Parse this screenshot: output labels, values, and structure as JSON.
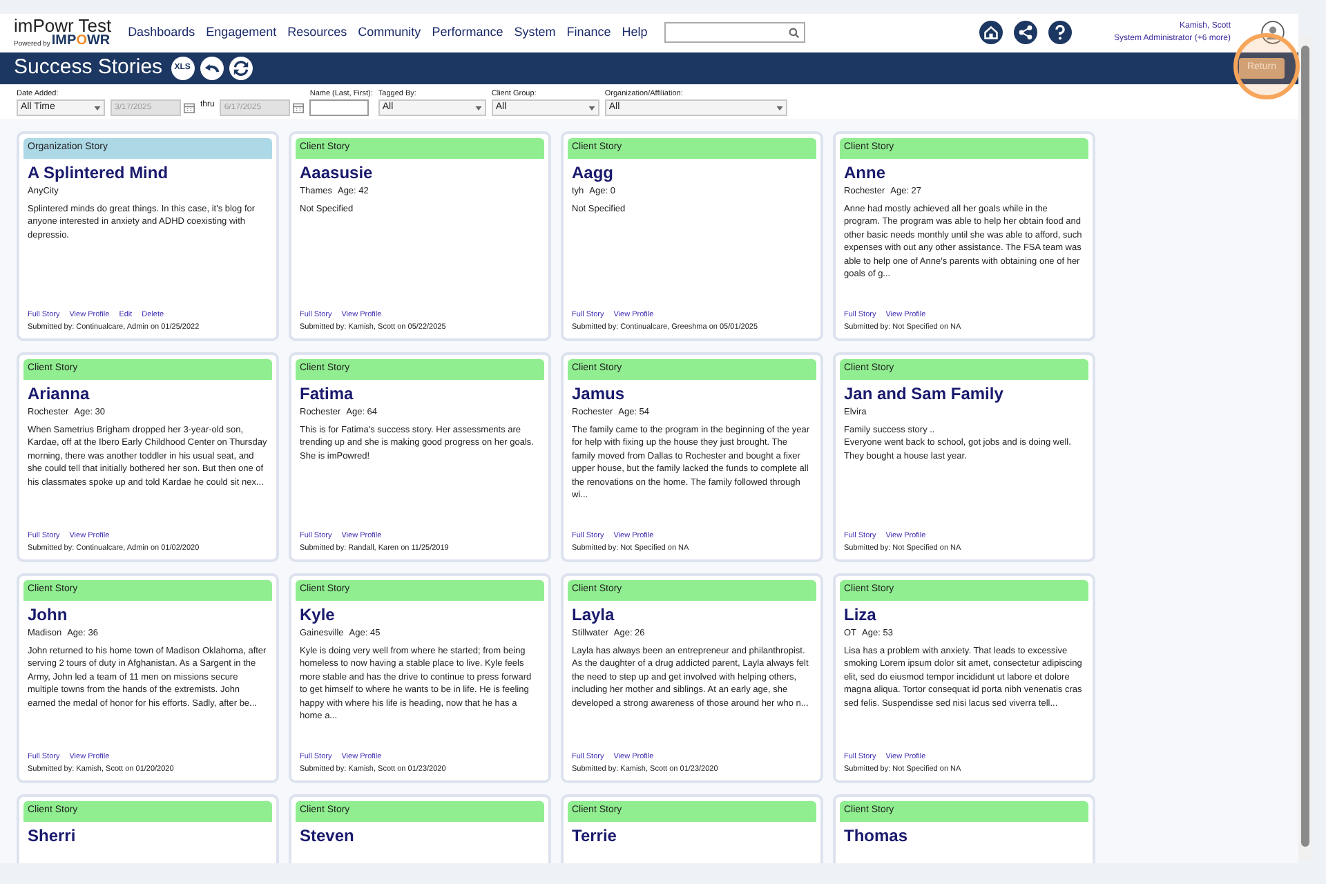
{
  "logo": {
    "title": "imPowr Test",
    "powered_by": "Powered by",
    "brand_parts": [
      {
        "text": "IMP",
        "accent": false
      },
      {
        "text": "O",
        "accent": true
      },
      {
        "text": "WR",
        "accent": false
      }
    ]
  },
  "nav": [
    "Dashboards",
    "Engagement",
    "Resources",
    "Community",
    "Performance",
    "System",
    "Finance",
    "Help"
  ],
  "user": {
    "name": "Kamish, Scott",
    "role": "System Administrator (+6 more)"
  },
  "toolbar": {
    "title": "Success Stories",
    "export_label": "XLS",
    "return_button": "Return",
    "return_highlighted": true
  },
  "filters": [
    {
      "kind": "select",
      "label": "Date Added:",
      "value": "All Time"
    },
    {
      "kind": "date",
      "value": "3/17/2025",
      "disabled": true
    },
    {
      "kind": "text",
      "label": "thru"
    },
    {
      "kind": "date",
      "value": "6/17/2025",
      "disabled": true
    },
    {
      "kind": "input",
      "label": "Name (Last, First):"
    },
    {
      "kind": "select",
      "label": "Tagged By:",
      "value": "All"
    },
    {
      "kind": "select",
      "label": "Client Group:",
      "value": "All"
    },
    {
      "kind": "select",
      "label": "Organization/Affiliation:",
      "value": "All"
    }
  ],
  "stories": [
    {
      "tag": "Organization Story",
      "color": "#add8e6",
      "name": "A Splintered Mind",
      "location": "AnyCity",
      "excerpt": "Splintered minds do great things. In this case, it's blog for anyone interested in anxiety and ADHD coexisting with depressio.",
      "links": [
        "Full Story",
        "View Profile",
        "Edit",
        "Delete"
      ],
      "submitted": "Submitted by: Continualcare, Admin on 01/25/2022"
    },
    {
      "tag": "Client Story",
      "color": "#90ee90",
      "name": "Aaasusie",
      "location": "Thames",
      "age": "Age: 42",
      "excerpt": "Not Specified",
      "links": [
        "Full Story",
        "View Profile"
      ],
      "submitted": "Submitted by: Kamish, Scott on 05/22/2025"
    },
    {
      "tag": "Client Story",
      "color": "#90ee90",
      "name": "Aagg",
      "location": "tyh",
      "age": "Age: 0",
      "excerpt": "Not Specified",
      "links": [
        "Full Story",
        "View Profile"
      ],
      "submitted": "Submitted by: Continualcare, Greeshma on 05/01/2025"
    },
    {
      "tag": "Client Story",
      "color": "#90ee90",
      "name": "Anne",
      "location": "Rochester",
      "age": "Age: 27",
      "excerpt": "Anne had mostly achieved all her goals while in the program. The program was able to help her obtain food and other basic needs monthly until she was able to afford, such expenses with out any other assistance. The FSA team was able to help one of Anne's parents with obtaining one of her goals of g...",
      "links": [
        "Full Story",
        "View Profile"
      ],
      "submitted": "Submitted by: Not Specified on NA"
    },
    {
      "tag": "Client Story",
      "color": "#90ee90",
      "name": "Arianna",
      "location": "Rochester",
      "age": "Age: 30",
      "excerpt": "When Sametrius Brigham dropped her 3-year-old son, Kardae, off at the Ibero Early Childhood Center on Thursday morning, there was another toddler in his usual seat, and she could tell that initially bothered her son. But then one of his classmates spoke up and told Kardae he could sit nex...",
      "links": [
        "Full Story",
        "View Profile"
      ],
      "submitted": "Submitted by: Continualcare, Admin on 01/02/2020"
    },
    {
      "tag": "Client Story",
      "color": "#90ee90",
      "name": "Fatima",
      "location": "Rochester",
      "age": "Age: 64",
      "excerpt": "This is for Fatima's success story.  Her assessments are trending up and she is making good progress on her goals.  She is imPowred!",
      "links": [
        "Full Story",
        "View Profile"
      ],
      "submitted": "Submitted by: Randall, Karen on 11/25/2019"
    },
    {
      "tag": "Client Story",
      "color": "#90ee90",
      "name": "Jamus",
      "location": "Rochester",
      "age": "Age: 54",
      "excerpt": "The family came to the program in the beginning of the year for help with fixing up the house they just brought. The family moved from Dallas to Rochester and bought a fixer upper house, but the family lacked the funds to complete all the renovations on the home. The family followed through wi...",
      "links": [
        "Full Story",
        "View Profile"
      ],
      "submitted": "Submitted by: Not Specified on NA"
    },
    {
      "tag": "Client Story",
      "color": "#90ee90",
      "name": "Jan and Sam Family",
      "location": "Elvira",
      "excerpt": "Family success story ..\nEveryone went back to school, got jobs and is doing well. They bought a house last year.",
      "links": [
        "Full Story",
        "View Profile"
      ],
      "submitted": "Submitted by: Not Specified on NA"
    },
    {
      "tag": "Client Story",
      "color": "#90ee90",
      "name": "John",
      "location": "Madison",
      "age": "Age: 36",
      "excerpt": "John returned to his home town of Madison Oklahoma, after serving 2 tours of duty in Afghanistan.  As a Sargent in the Army, John led a team of 11 men on missions secure multiple towns from the hands of the extremists.  John earned the medal of honor for his efforts.  Sadly, after be...",
      "links": [
        "Full Story",
        "View Profile"
      ],
      "submitted": "Submitted by: Kamish, Scott on 01/20/2020"
    },
    {
      "tag": "Client Story",
      "color": "#90ee90",
      "name": "Kyle",
      "location": "Gainesville",
      "age": "Age: 45",
      "excerpt": "Kyle is doing very well from where he started; from being homeless to now having a stable place to live. Kyle feels more stable and has the drive to continue to press forward to get himself to where he wants to be in life. He is feeling happy with where his life is heading, now that he has a home a...",
      "links": [
        "Full Story",
        "View Profile"
      ],
      "submitted": "Submitted by: Kamish, Scott on 01/23/2020"
    },
    {
      "tag": "Client Story",
      "color": "#90ee90",
      "name": "Layla",
      "location": "Stillwater",
      "age": "Age: 26",
      "excerpt": "Layla has always been an entrepreneur and philanthropist.  As the daughter of a drug addicted parent, Layla always felt the need to step up and get involved with helping others, including her mother and siblings.  At an early age, she developed a strong awareness of those around her who n...",
      "links": [
        "Full Story",
        "View Profile"
      ],
      "submitted": "Submitted by: Kamish, Scott on 01/23/2020"
    },
    {
      "tag": "Client Story",
      "color": "#90ee90",
      "name": "Liza",
      "location": "OT",
      "age": "Age: 53",
      "excerpt": "Lisa has a problem with anxiety. That leads to excessive smoking Lorem ipsum dolor sit amet, consectetur adipiscing elit, sed do eiusmod tempor incididunt ut labore et dolore magna aliqua. Tortor consequat id porta nibh venenatis cras sed felis. Suspendisse sed nisi lacus sed viverra tell...",
      "links": [
        "Full Story",
        "View Profile"
      ],
      "submitted": "Submitted by: Not Specified on NA"
    },
    {
      "tag": "Client Story",
      "color": "#90ee90",
      "name": "Sherri"
    },
    {
      "tag": "Client Story",
      "color": "#90ee90",
      "name": "Steven"
    },
    {
      "tag": "Client Story",
      "color": "#90ee90",
      "name": "Terrie"
    },
    {
      "tag": "Client Story",
      "color": "#90ee90",
      "name": "Thomas"
    }
  ]
}
